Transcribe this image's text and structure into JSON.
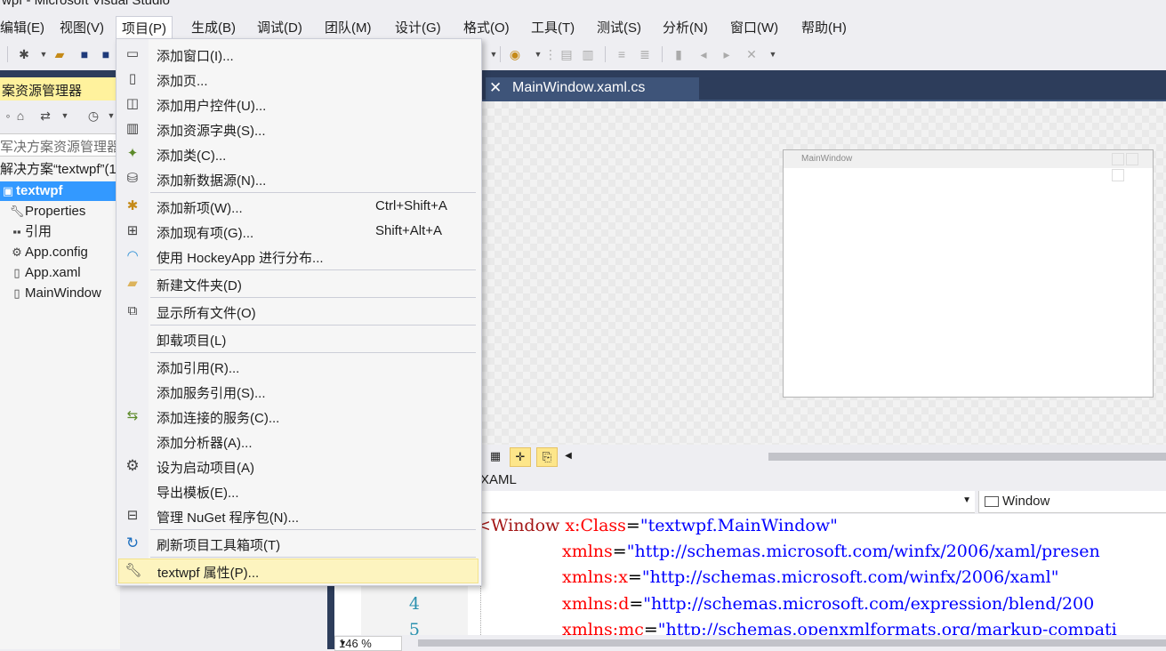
{
  "window": {
    "title": "wpf - Microsoft Visual Studio"
  },
  "menubar": {
    "items": [
      "编辑(E)",
      "视图(V)",
      "项目(P)",
      "生成(B)",
      "调试(D)",
      "团队(M)",
      "设计(G)",
      "格式(O)",
      "工具(T)",
      "测试(S)",
      "分析(N)",
      "窗口(W)",
      "帮助(H)"
    ],
    "active": "项目(P)"
  },
  "solution_explorer": {
    "title": "案资源管理器",
    "search_placeholder": "军决方案资源管理器(",
    "solution_label": "解决方案“textwpf”(1",
    "project": "textwpf",
    "items": [
      {
        "label": "Properties",
        "icon": "wrench-icon"
      },
      {
        "label": "引用",
        "icon": "references-icon"
      },
      {
        "label": "App.config",
        "icon": "config-file-icon"
      },
      {
        "label": "App.xaml",
        "icon": "xaml-file-icon"
      },
      {
        "label": "MainWindow",
        "icon": "xaml-file-icon"
      }
    ]
  },
  "document_tab": {
    "label": "MainWindow.xaml.cs",
    "close": "✕"
  },
  "designer": {
    "window_caption": "MainWindow"
  },
  "xaml_tab": {
    "label": "XAML"
  },
  "element_combo": {
    "value": "Window"
  },
  "zoom": {
    "value": "146 %"
  },
  "editor": {
    "line_numbers": [
      "4",
      "5"
    ],
    "lines": [
      {
        "parts": [
          {
            "t": "<Window ",
            "c": "tag"
          },
          {
            "t": "x:Class",
            "c": "attr"
          },
          {
            "t": "=",
            "c": "plain"
          },
          {
            "t": "\"textwpf.MainWindow\"",
            "c": "val"
          }
        ]
      },
      {
        "parts": [
          {
            "t": "xmlns",
            "c": "attr"
          },
          {
            "t": "=",
            "c": "plain"
          },
          {
            "t": "\"http://schemas.microsoft.com/winfx/2006/xaml/presen",
            "c": "val"
          }
        ]
      },
      {
        "parts": [
          {
            "t": "xmlns:x",
            "c": "attr"
          },
          {
            "t": "=",
            "c": "plain"
          },
          {
            "t": "\"http://schemas.microsoft.com/winfx/2006/xaml\"",
            "c": "val"
          }
        ]
      },
      {
        "parts": [
          {
            "t": "xmlns:d",
            "c": "attr"
          },
          {
            "t": "=",
            "c": "plain"
          },
          {
            "t": "\"http://schemas.microsoft.com/expression/blend/200",
            "c": "val"
          }
        ]
      },
      {
        "parts": [
          {
            "t": "xmlns:mc",
            "c": "attr"
          },
          {
            "t": "=",
            "c": "plain"
          },
          {
            "t": "\"http://schemas.openxmlformats.org/markup-compati",
            "c": "val"
          }
        ]
      }
    ]
  },
  "project_menu": {
    "items": [
      {
        "label": "添加窗口(I)...",
        "shortcut": "",
        "icon": "add-window-icon"
      },
      {
        "label": "添加页...",
        "shortcut": "",
        "icon": "add-page-icon"
      },
      {
        "label": "添加用户控件(U)...",
        "shortcut": "",
        "icon": "add-user-control-icon"
      },
      {
        "label": "添加资源字典(S)...",
        "shortcut": "",
        "icon": "add-resource-dictionary-icon"
      },
      {
        "label": "添加类(C)...",
        "shortcut": "",
        "icon": "add-class-icon"
      },
      {
        "label": "添加新数据源(N)...",
        "shortcut": "",
        "icon": "add-data-source-icon"
      },
      {
        "label": "添加新项(W)...",
        "shortcut": "Ctrl+Shift+A",
        "icon": "add-new-item-icon"
      },
      {
        "label": "添加现有项(G)...",
        "shortcut": "Shift+Alt+A",
        "icon": "add-existing-item-icon"
      },
      {
        "label": "使用 HockeyApp 进行分布...",
        "shortcut": "",
        "icon": "hockeyapp-icon"
      },
      {
        "label": "新建文件夹(D)",
        "shortcut": "",
        "icon": "new-folder-icon"
      },
      {
        "label": "显示所有文件(O)",
        "shortcut": "",
        "icon": "show-all-files-icon"
      },
      {
        "label": "卸载项目(L)",
        "shortcut": "",
        "icon": ""
      },
      {
        "label": "添加引用(R)...",
        "shortcut": "",
        "icon": ""
      },
      {
        "label": "添加服务引用(S)...",
        "shortcut": "",
        "icon": ""
      },
      {
        "label": "添加连接的服务(C)...",
        "shortcut": "",
        "icon": "connected-service-icon"
      },
      {
        "label": "添加分析器(A)...",
        "shortcut": "",
        "icon": ""
      },
      {
        "label": "设为启动项目(A)",
        "shortcut": "",
        "icon": "gear-icon"
      },
      {
        "label": "导出模板(E)...",
        "shortcut": "",
        "icon": ""
      },
      {
        "label": "管理 NuGet 程序包(N)...",
        "shortcut": "",
        "icon": "nuget-icon"
      },
      {
        "label": "刷新项目工具箱项(T)",
        "shortcut": "",
        "icon": "refresh-icon"
      },
      {
        "label": "textwpf 属性(P)...",
        "shortcut": "",
        "icon": "wrench-icon"
      }
    ],
    "highlighted_index": 20
  }
}
